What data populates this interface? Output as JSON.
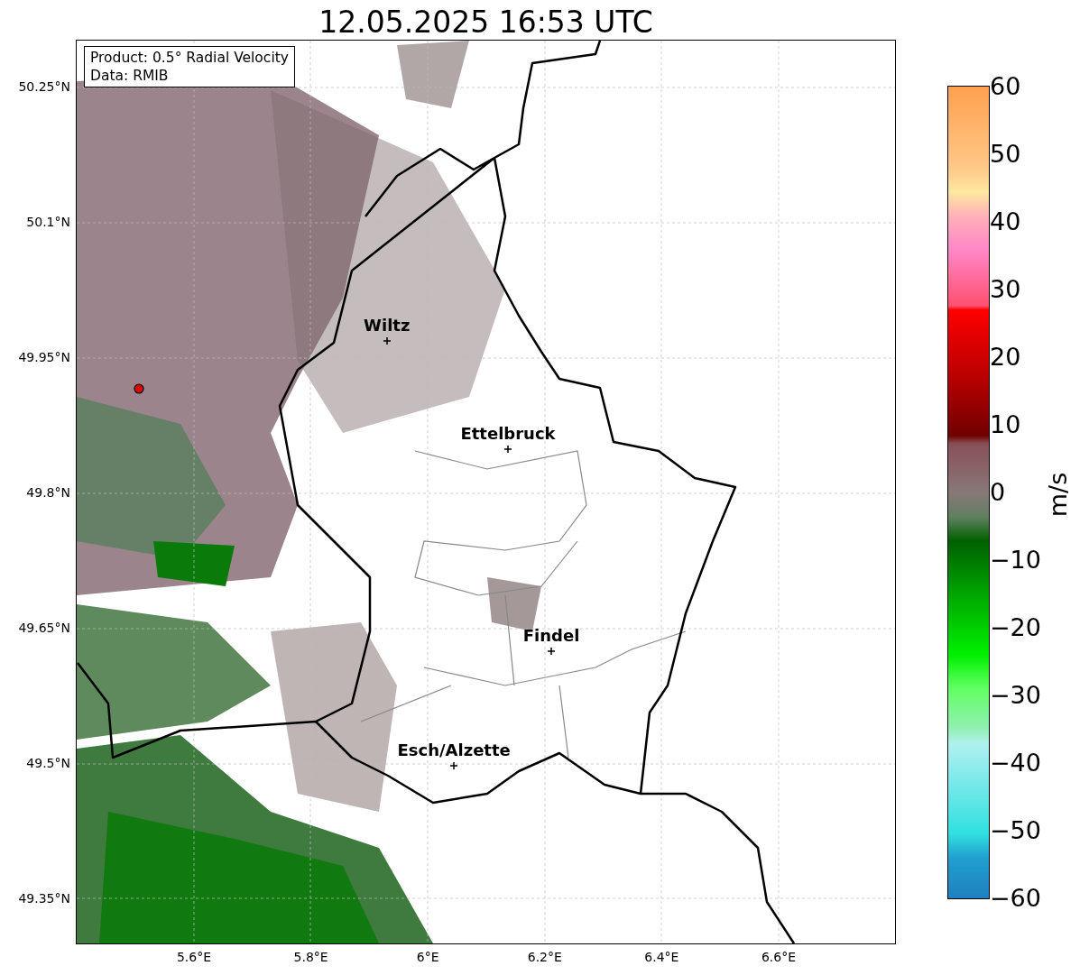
{
  "title": "12.05.2025 16:53 UTC",
  "legend": [
    "Product: 0.5° Radial Velocity",
    "Data: RMIB"
  ],
  "map": {
    "lat_ticks": [
      "50.25°N",
      "50.1°N",
      "49.95°N",
      "49.8°N",
      "49.65°N",
      "49.5°N",
      "49.35°N"
    ],
    "lon_ticks": [
      "5.6°E",
      "5.8°E",
      "6°E",
      "6.2°E",
      "6.4°E",
      "6.6°E"
    ],
    "cities": [
      {
        "name": "Wiltz"
      },
      {
        "name": "Ettelbruck"
      },
      {
        "name": "Findel"
      },
      {
        "name": "Esch/Alzette"
      }
    ]
  },
  "colorbar": {
    "label": "m/s",
    "ticks": [
      "60",
      "50",
      "40",
      "30",
      "20",
      "10",
      "0",
      "−10",
      "−20",
      "−30",
      "−40",
      "−50",
      "−60"
    ]
  }
}
